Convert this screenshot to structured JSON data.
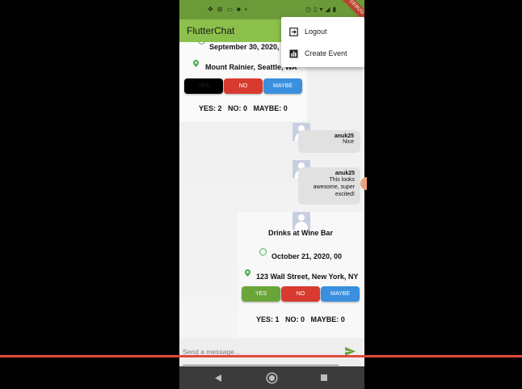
{
  "status_bar": {
    "debug_label": "DEBUG"
  },
  "app_bar": {
    "title": "FlutterChat"
  },
  "menu": {
    "items": [
      {
        "label": "Logout",
        "icon": "logout-icon"
      },
      {
        "label": "Create Event",
        "icon": "bar-chart-icon"
      }
    ]
  },
  "event1": {
    "date": "September 30, 2020, 0",
    "location": "Mount Rainier, Seattle, WA",
    "buttons": {
      "yes": "YES",
      "no": "NO",
      "maybe": "MAYBE"
    },
    "counts": "YES: 2   NO: 0   MAYBE: 0",
    "colors": {
      "yes_selected": "#000000",
      "no": "#d93a2f",
      "maybe": "#3a8fde"
    }
  },
  "messages": [
    {
      "author": "anuk25",
      "text": "Nice"
    },
    {
      "author": "anuk25",
      "text": "This looks awesome, super excited!"
    }
  ],
  "event2": {
    "title": "Drinks at Wine Bar",
    "date": "October 21, 2020, 00",
    "location": "123 Wall Street, New York, NY",
    "buttons": {
      "yes": "YES",
      "no": "NO",
      "maybe": "MAYBE"
    },
    "counts": "YES: 1   NO: 0   MAYBE: 0",
    "colors": {
      "yes": "#6aa53a",
      "no": "#d93a2f",
      "maybe": "#3a8fde"
    }
  },
  "composer": {
    "placeholder": "Send a message..."
  },
  "theme": {
    "appbar": "#8cc04c",
    "statusbar": "#6a9b38",
    "accent_green": "#4caf50"
  }
}
